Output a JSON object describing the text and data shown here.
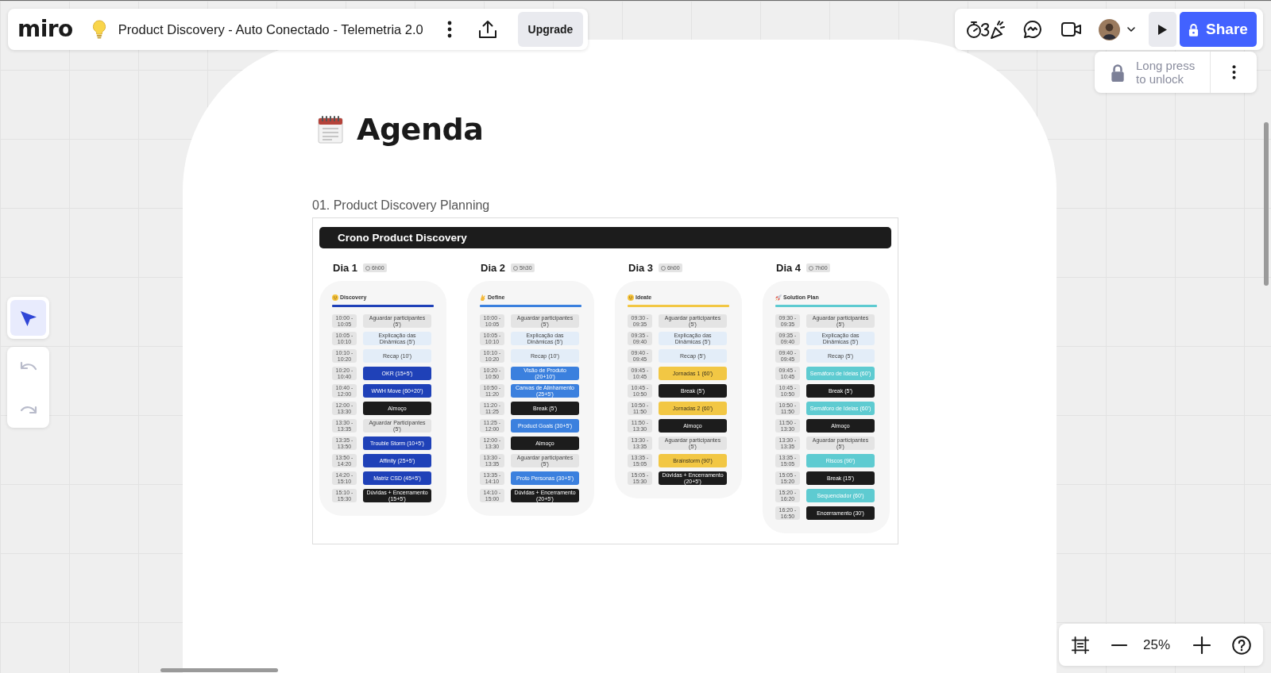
{
  "top_bar": {
    "logo": "miro",
    "board_name": "Product Discovery - Auto Conectado - Telemetria 2.0",
    "upgrade_button": "Upgrade"
  },
  "collab_bar": {
    "share_button": "Share",
    "lock_hint": "Long press to unlock"
  },
  "left_tools": [
    {
      "kind": "select",
      "selected": true
    }
  ],
  "history": [
    {
      "kind": "undo",
      "disabled": true
    },
    {
      "kind": "redo",
      "disabled": true
    }
  ],
  "zoom_bar": {
    "zoom_level": "25%"
  },
  "frame": {
    "title": "Agenda",
    "section": "01. Product Discovery Planning",
    "board": {
      "title": "Crono Product Discovery",
      "days": [
        {
          "name": "Dia 1",
          "duration": "6h00",
          "phase": "Discovery",
          "color": "#1f41b8",
          "slots": [
            {
              "time": "10:00 - 10:05",
              "activity": "Aguardar participantes (5')",
              "kind": "wait"
            },
            {
              "time": "10:05 - 10:10",
              "activity": "Explicação das Dinâmicas (5')",
              "kind": "intro"
            },
            {
              "time": "10:10 - 10:20",
              "activity": "Recap (10')",
              "kind": "intro"
            },
            {
              "time": "10:20 - 10:40",
              "activity": "OKR (15+5')",
              "kind": "session"
            },
            {
              "time": "10:40 - 12:00",
              "activity": "WWH Move (60+20')",
              "kind": "session"
            },
            {
              "time": "12:00 - 13:30",
              "activity": "Almoço",
              "kind": "pause"
            },
            {
              "time": "13:30 - 13:35",
              "activity": "Aguardar Participantes (5')",
              "kind": "wait"
            },
            {
              "time": "13:35 - 13:50",
              "activity": "Trouble Storm (10+5')",
              "kind": "session"
            },
            {
              "time": "13:50 - 14:20",
              "activity": "Affinity (25+5')",
              "kind": "session"
            },
            {
              "time": "14:20 - 15:10",
              "activity": "Matriz CSD (45+5')",
              "kind": "session"
            },
            {
              "time": "15:10 - 15:30",
              "activity": "Dúvidas + Encerramento (15+5')",
              "kind": "pause"
            }
          ]
        },
        {
          "name": "Dia 2",
          "duration": "5h30",
          "phase": "Define",
          "color": "#3b80de",
          "slots": [
            {
              "time": "10:00 - 10:05",
              "activity": "Aguardar participantes (5')",
              "kind": "wait"
            },
            {
              "time": "10:05 - 10:10",
              "activity": "Explicação das Dinâmicas (5')",
              "kind": "intro"
            },
            {
              "time": "10:10 - 10:20",
              "activity": "Recap (10')",
              "kind": "intro"
            },
            {
              "time": "10:20 - 10:50",
              "activity": "Visão de Produto (20+10')",
              "kind": "session"
            },
            {
              "time": "10:50 - 11:20",
              "activity": "Canvas de Alinhamento (25+5')",
              "kind": "session"
            },
            {
              "time": "11:20 - 11:25",
              "activity": "Break (5')",
              "kind": "pause"
            },
            {
              "time": "11:25 - 12:00",
              "activity": "Product Goals (30+5')",
              "kind": "session"
            },
            {
              "time": "12:00 - 13:30",
              "activity": "Almoço",
              "kind": "pause"
            },
            {
              "time": "13:30 - 13:35",
              "activity": "Aguardar participantes (5')",
              "kind": "wait"
            },
            {
              "time": "13:35 - 14:10",
              "activity": "Proto Personas (30+5')",
              "kind": "session"
            },
            {
              "time": "14:10 - 15:00",
              "activity": "Dúvidas + Encerramento (20+5')",
              "kind": "pause"
            }
          ]
        },
        {
          "name": "Dia 3",
          "duration": "6h00",
          "phase": "Ideate",
          "color": "#f2c744",
          "slots": [
            {
              "time": "09:30 - 09:35",
              "activity": "Aguardar participantes (5')",
              "kind": "wait"
            },
            {
              "time": "09:35 - 09:40",
              "activity": "Explicação das Dinâmicas (5')",
              "kind": "intro"
            },
            {
              "time": "09:40 - 09:45",
              "activity": "Recap (5')",
              "kind": "intro"
            },
            {
              "time": "09:45 - 10:45",
              "activity": "Jornadas 1 (60')",
              "kind": "session"
            },
            {
              "time": "10:45 - 10:50",
              "activity": "Break (5')",
              "kind": "pause"
            },
            {
              "time": "10:50 - 11:50",
              "activity": "Jornadas 2 (60')",
              "kind": "session"
            },
            {
              "time": "11:50 - 13:30",
              "activity": "Almoço",
              "kind": "pause"
            },
            {
              "time": "13:30 - 13:35",
              "activity": "Aguardar participantes (5')",
              "kind": "wait"
            },
            {
              "time": "13:35 - 15:05",
              "activity": "Brainstorm (90')",
              "kind": "session"
            },
            {
              "time": "15:05 - 15:30",
              "activity": "Dúvidas + Encerramento (20+5')",
              "kind": "pause"
            }
          ]
        },
        {
          "name": "Dia 4",
          "duration": "7h00",
          "phase": "Solution Plan",
          "color": "#5ecbd1",
          "slots": [
            {
              "time": "09:30 - 09:35",
              "activity": "Aguardar participantes (5')",
              "kind": "wait"
            },
            {
              "time": "09:35 - 09:40",
              "activity": "Explicação das Dinâmicas (5')",
              "kind": "intro"
            },
            {
              "time": "09:40 - 09:45",
              "activity": "Recap (5')",
              "kind": "intro"
            },
            {
              "time": "09:45 - 10:45",
              "activity": "Semáforo de Ideias (60')",
              "kind": "session"
            },
            {
              "time": "10:45 - 10:50",
              "activity": "Break (5')",
              "kind": "pause"
            },
            {
              "time": "10:50 - 11:50",
              "activity": "Semáforo de Ideias (60')",
              "kind": "session"
            },
            {
              "time": "11:50 - 13:30",
              "activity": "Almoço",
              "kind": "pause"
            },
            {
              "time": "13:30 - 13:35",
              "activity": "Aguardar participantes (5')",
              "kind": "wait"
            },
            {
              "time": "13:35 - 15:05",
              "activity": "Riscos (90')",
              "kind": "session"
            },
            {
              "time": "15:05 - 15:20",
              "activity": "Break (15')",
              "kind": "pause"
            },
            {
              "time": "15:20 - 16:20",
              "activity": "Sequenciador (60')",
              "kind": "session"
            },
            {
              "time": "16:20 - 16:50",
              "activity": "Encerramento (30')",
              "kind": "pause"
            }
          ]
        }
      ]
    }
  }
}
